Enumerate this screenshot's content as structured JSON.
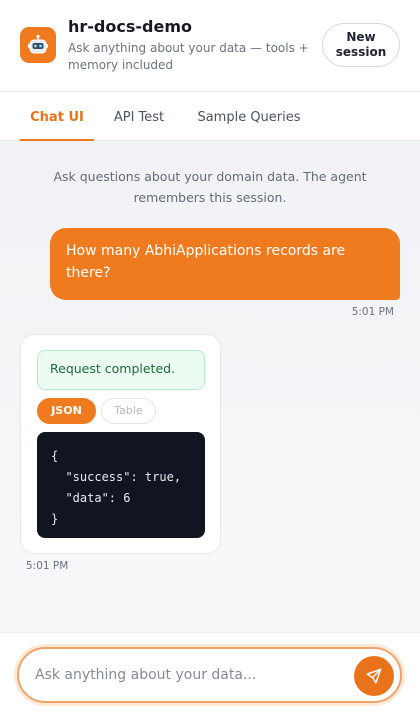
{
  "header": {
    "app_icon": "robot-icon",
    "title": "hr-docs-demo",
    "subtitle": "Ask anything about your data — tools + memory included",
    "new_session_label": "New session"
  },
  "tabs": [
    {
      "label": "Chat UI",
      "active": true
    },
    {
      "label": "API Test",
      "active": false
    },
    {
      "label": "Sample Queries",
      "active": false
    }
  ],
  "chat": {
    "intro": "Ask questions about your domain data. The agent remembers this session.",
    "messages": [
      {
        "role": "user",
        "text": "How many AbhiApplications records are there?",
        "time": "5:01 PM"
      },
      {
        "role": "assistant",
        "status": "Request completed.",
        "view_toggle": {
          "json_label": "JSON",
          "table_label": "Table",
          "selected": "JSON"
        },
        "code": "{\n  \"success\": true,\n  \"data\": 6\n}",
        "time": "5:01 PM"
      }
    ]
  },
  "composer": {
    "placeholder": "Ask anything about your data...",
    "value": "",
    "send_icon": "send-icon"
  },
  "colors": {
    "accent": "#f07b1e",
    "success_bg": "#ecfbf1",
    "success_text": "#1c6b3c",
    "code_bg": "#101521"
  }
}
